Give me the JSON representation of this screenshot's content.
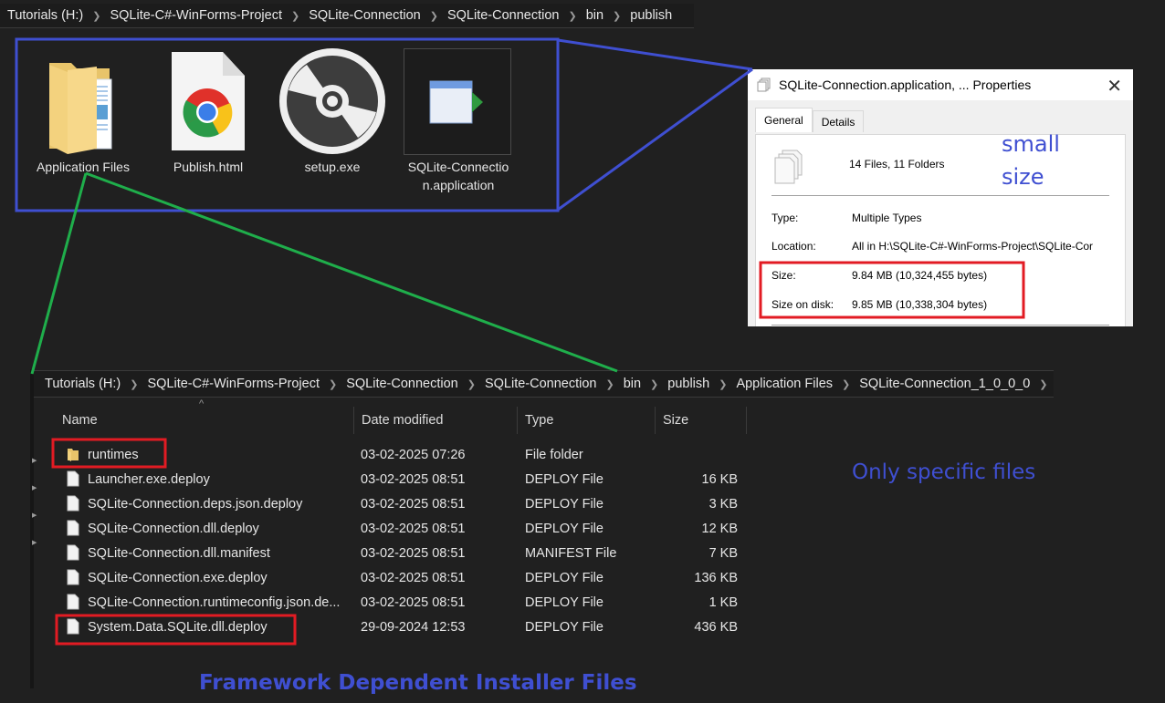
{
  "top_explorer": {
    "breadcrumb": [
      "Tutorials (H:)",
      "SQLite-C#-WinForms-Project",
      "SQLite-Connection",
      "SQLite-Connection",
      "bin",
      "publish"
    ],
    "items": [
      {
        "name": "Application Files",
        "icon": "folder-icon"
      },
      {
        "name": "Publish.html",
        "icon": "chrome-html-icon"
      },
      {
        "name": "setup.exe",
        "icon": "disc-setup-icon"
      },
      {
        "name": "SQLite-Connectio",
        "name_line2": "n.application",
        "icon": "application-manifest-icon"
      }
    ]
  },
  "properties_dialog": {
    "title": "SQLite-Connection.application, ... Properties",
    "tabs": [
      "General",
      "Details"
    ],
    "active_tab": "General",
    "summary": "14 Files, 11 Folders",
    "fields": [
      {
        "label": "Type:",
        "value": "Multiple Types"
      },
      {
        "label": "Location:",
        "value": "All in H:\\SQLite-C#-WinForms-Project\\SQLite-Cor"
      },
      {
        "label": "Size:",
        "value": "9.84 MB (10,324,455 bytes)"
      },
      {
        "label": "Size on disk:",
        "value": "9.85 MB (10,338,304 bytes)"
      }
    ]
  },
  "lower_explorer": {
    "breadcrumb": [
      "Tutorials (H:)",
      "SQLite-C#-WinForms-Project",
      "SQLite-Connection",
      "SQLite-Connection",
      "bin",
      "publish",
      "Application Files",
      "SQLite-Connection_1_0_0_0"
    ],
    "columns": [
      "Name",
      "Date modified",
      "Type",
      "Size"
    ],
    "sort_indicator": "^",
    "rows": [
      {
        "name": "runtimes",
        "date": "03-02-2025 07:26",
        "type": "File folder",
        "size": "",
        "kind": "folder"
      },
      {
        "name": "Launcher.exe.deploy",
        "date": "03-02-2025 08:51",
        "type": "DEPLOY File",
        "size": "16 KB",
        "kind": "file"
      },
      {
        "name": "SQLite-Connection.deps.json.deploy",
        "date": "03-02-2025 08:51",
        "type": "DEPLOY File",
        "size": "3 KB",
        "kind": "file"
      },
      {
        "name": "SQLite-Connection.dll.deploy",
        "date": "03-02-2025 08:51",
        "type": "DEPLOY File",
        "size": "12 KB",
        "kind": "file"
      },
      {
        "name": "SQLite-Connection.dll.manifest",
        "date": "03-02-2025 08:51",
        "type": "MANIFEST File",
        "size": "7 KB",
        "kind": "file"
      },
      {
        "name": "SQLite-Connection.exe.deploy",
        "date": "03-02-2025 08:51",
        "type": "DEPLOY File",
        "size": "136 KB",
        "kind": "file"
      },
      {
        "name": "SQLite-Connection.runtimeconfig.json.de...",
        "date": "03-02-2025 08:51",
        "type": "DEPLOY File",
        "size": "1 KB",
        "kind": "file"
      },
      {
        "name": "System.Data.SQLite.dll.deploy",
        "date": "29-09-2024 12:53",
        "type": "DEPLOY File",
        "size": "436 KB",
        "kind": "file"
      }
    ]
  },
  "annotations": {
    "small_size_line1": "small",
    "small_size_line2": "size",
    "only_specific": "Only specific files",
    "framework_dependent": "Framework Dependent Installer Files",
    "colors": {
      "blue": "#3f4fd1",
      "green": "#1fae4b",
      "red": "#e21b23"
    }
  }
}
